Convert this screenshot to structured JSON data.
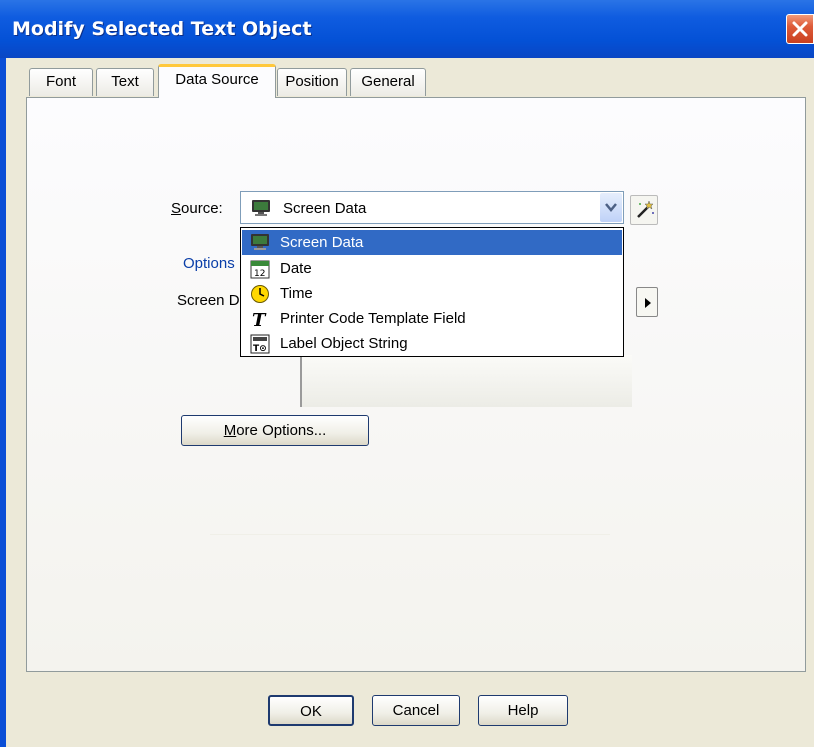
{
  "window": {
    "title": "Modify Selected Text Object"
  },
  "tabs": [
    {
      "label": "Font",
      "active": false
    },
    {
      "label": "Text",
      "active": false
    },
    {
      "label": "Data Source",
      "active": true
    },
    {
      "label": "Position",
      "active": false
    },
    {
      "label": "General",
      "active": false
    }
  ],
  "source": {
    "label_rest": "ource:",
    "label_underlined": "S",
    "selected": "Screen Data",
    "options": [
      {
        "label": "Screen Data",
        "icon": "monitor-icon",
        "selected": true
      },
      {
        "label": "Date",
        "icon": "calendar-icon",
        "selected": false
      },
      {
        "label": "Time",
        "icon": "clock-icon",
        "selected": false
      },
      {
        "label": "Printer Code Template Field",
        "icon": "italic-t-icon",
        "selected": false
      },
      {
        "label": "Label Object String",
        "icon": "label-object-icon",
        "selected": false
      }
    ]
  },
  "options_link": "Options",
  "screen_label": "Screen D",
  "more_options": {
    "underlined": "M",
    "rest": "ore Options..."
  },
  "buttons": {
    "ok": "OK",
    "cancel": "Cancel",
    "help": "Help"
  },
  "colors": {
    "titlebar": "#0451d6",
    "selection": "#316ac5",
    "active_tab": "#ffc83c"
  }
}
